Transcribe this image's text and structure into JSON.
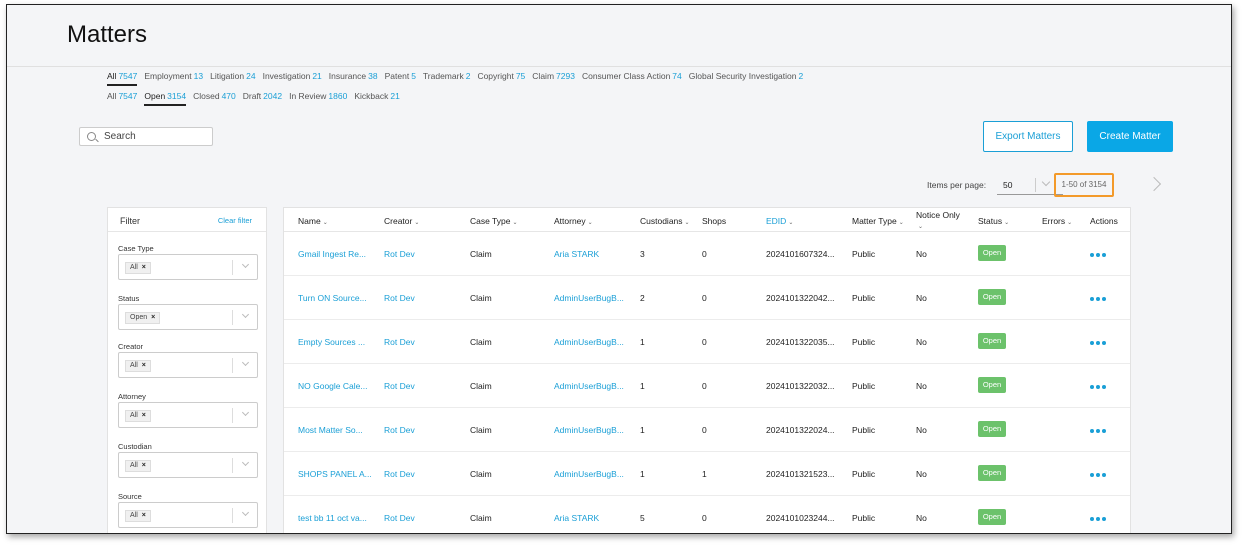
{
  "page": {
    "title": "Matters"
  },
  "case_type_tabs": [
    {
      "label": "All",
      "count": "7547",
      "active": true
    },
    {
      "label": "Employment",
      "count": "13"
    },
    {
      "label": "Litigation",
      "count": "24"
    },
    {
      "label": "Investigation",
      "count": "21"
    },
    {
      "label": "Insurance",
      "count": "38"
    },
    {
      "label": "Patent",
      "count": "5"
    },
    {
      "label": "Trademark",
      "count": "2"
    },
    {
      "label": "Copyright",
      "count": "75"
    },
    {
      "label": "Claim",
      "count": "7293"
    },
    {
      "label": "Consumer Class Action",
      "count": "74"
    },
    {
      "label": "Global Security Investigation",
      "count": "2"
    }
  ],
  "status_tabs": [
    {
      "label": "All",
      "count": "7547"
    },
    {
      "label": "Open",
      "count": "3154",
      "active": true
    },
    {
      "label": "Closed",
      "count": "470"
    },
    {
      "label": "Draft",
      "count": "2042"
    },
    {
      "label": "In Review",
      "count": "1860"
    },
    {
      "label": "Kickback",
      "count": "21"
    }
  ],
  "search": {
    "placeholder": "Search"
  },
  "toolbar": {
    "export_label": "Export Matters",
    "create_label": "Create Matter"
  },
  "pager": {
    "items_per_page_label": "Items per page:",
    "items_per_page": "50",
    "range": "1-50 of 3154"
  },
  "filter_panel": {
    "title": "Filter",
    "clear": "Clear filter",
    "groups": [
      {
        "label": "Case Type",
        "tag": "All"
      },
      {
        "label": "Status",
        "tag": "Open"
      },
      {
        "label": "Creator",
        "tag": "All"
      },
      {
        "label": "Attorney",
        "tag": "All"
      },
      {
        "label": "Custodian",
        "tag": "All"
      },
      {
        "label": "Source",
        "tag": "All"
      }
    ]
  },
  "table": {
    "columns": {
      "name": "Name",
      "creator": "Creator",
      "case_type": "Case Type",
      "attorney": "Attorney",
      "custodians": "Custodians",
      "shops": "Shops",
      "edid": "EDID",
      "matter_type": "Matter Type",
      "notice_only": "Notice Only",
      "status": "Status",
      "errors": "Errors",
      "actions": "Actions"
    },
    "rows": [
      {
        "name": "Gmail Ingest Re...",
        "creator": "Rot Dev",
        "case_type": "Claim",
        "attorney": "Aria STARK",
        "custodians": "3",
        "shops": "0",
        "edid": "2024101607324...",
        "matter_type": "Public",
        "notice_only": "No",
        "status": "Open"
      },
      {
        "name": "Turn ON Source...",
        "creator": "Rot Dev",
        "case_type": "Claim",
        "attorney": "AdminUserBugB...",
        "custodians": "2",
        "shops": "0",
        "edid": "2024101322042...",
        "matter_type": "Public",
        "notice_only": "No",
        "status": "Open"
      },
      {
        "name": "Empty Sources ...",
        "creator": "Rot Dev",
        "case_type": "Claim",
        "attorney": "AdminUserBugB...",
        "custodians": "1",
        "shops": "0",
        "edid": "2024101322035...",
        "matter_type": "Public",
        "notice_only": "No",
        "status": "Open"
      },
      {
        "name": "NO Google Cale...",
        "creator": "Rot Dev",
        "case_type": "Claim",
        "attorney": "AdminUserBugB...",
        "custodians": "1",
        "shops": "0",
        "edid": "2024101322032...",
        "matter_type": "Public",
        "notice_only": "No",
        "status": "Open"
      },
      {
        "name": "Most Matter So...",
        "creator": "Rot Dev",
        "case_type": "Claim",
        "attorney": "AdminUserBugB...",
        "custodians": "1",
        "shops": "0",
        "edid": "2024101322024...",
        "matter_type": "Public",
        "notice_only": "No",
        "status": "Open"
      },
      {
        "name": "SHOPS PANEL A...",
        "creator": "Rot Dev",
        "case_type": "Claim",
        "attorney": "AdminUserBugB...",
        "custodians": "1",
        "shops": "1",
        "edid": "2024101321523...",
        "matter_type": "Public",
        "notice_only": "No",
        "status": "Open"
      },
      {
        "name": "test bb 11 oct va...",
        "creator": "Rot Dev",
        "case_type": "Claim",
        "attorney": "Aria STARK",
        "custodians": "5",
        "shops": "0",
        "edid": "2024101023244...",
        "matter_type": "Public",
        "notice_only": "No",
        "status": "Open"
      }
    ]
  },
  "colors": {
    "accent": "#1a9fd6",
    "primary_button": "#0aa7e6",
    "status_open": "#6cc26b",
    "highlight": "#f39a2a"
  }
}
